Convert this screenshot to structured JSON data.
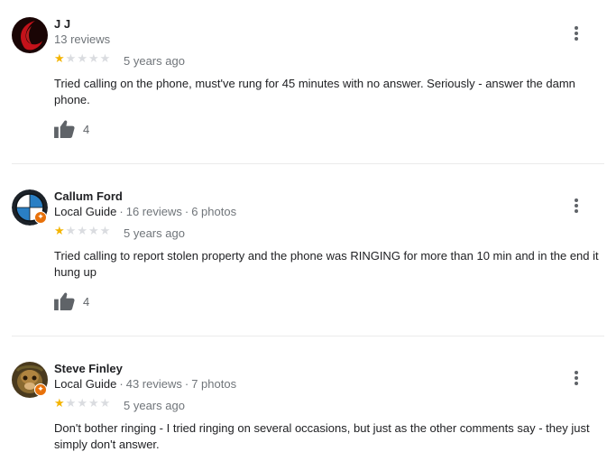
{
  "reviews": [
    {
      "name": "J J",
      "reviews_count": "13 reviews",
      "local_guide": "",
      "photos": "",
      "rating": 1,
      "time": "5 years ago",
      "text": "Tried calling on the phone, must've rung for 45 minutes with no answer. Seriously - answer the damn phone.",
      "likes": "4"
    },
    {
      "name": "Callum Ford",
      "reviews_count": "16 reviews",
      "local_guide": "Local Guide",
      "photos": "6 photos",
      "rating": 1,
      "time": "5 years ago",
      "text": "Tried calling to report stolen property and the phone was RINGING for more than 10 min and in the end it hung up",
      "likes": "4"
    },
    {
      "name": "Steve Finley",
      "reviews_count": "43 reviews",
      "local_guide": "Local Guide",
      "photos": "7 photos",
      "rating": 1,
      "time": "5 years ago",
      "text": "Don't  bother ringing - I tried ringing on several occasions, but just as the other comments say - they just simply don't answer.",
      "likes": ""
    }
  ],
  "separator": "·",
  "icons": {
    "star": "star-icon",
    "like": "thumbs-up-icon",
    "more": "more-vert-icon",
    "guide_badge": "local-guide-badge-icon"
  },
  "colors": {
    "star_filled": "#f4b400",
    "star_empty": "#dadce0",
    "guide_badge": "#e8710a"
  }
}
